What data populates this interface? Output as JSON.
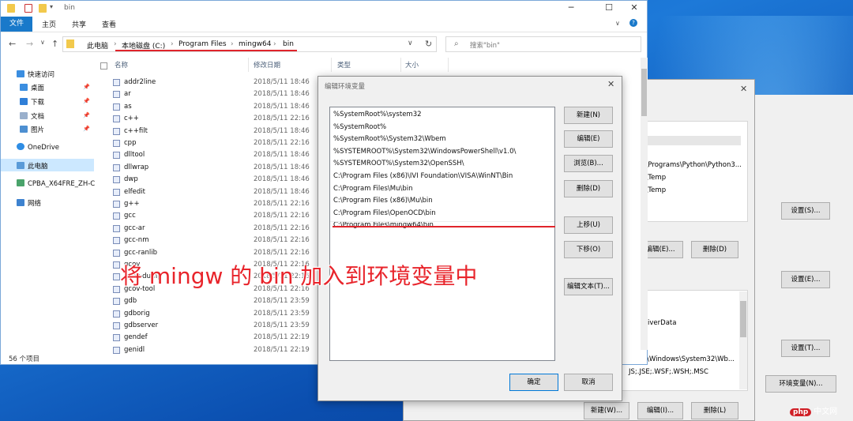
{
  "explorer": {
    "title": "bin",
    "ribbon": {
      "file": "文件",
      "tabs": [
        "主页",
        "共享",
        "查看"
      ]
    },
    "nav": {
      "back": "←",
      "forward": "→",
      "dropdown": "∨",
      "up": "↑",
      "refresh": "↻"
    },
    "address": [
      "此电脑",
      "本地磁盘 (C:)",
      "Program Files",
      "mingw64",
      "bin"
    ],
    "search_placeholder": "搜索\"bin\"",
    "sidebar": [
      {
        "label": "快速访问",
        "pinned": false
      },
      {
        "label": "桌面",
        "pinned": true
      },
      {
        "label": "下载",
        "pinned": true
      },
      {
        "label": "文档",
        "pinned": true
      },
      {
        "label": "图片",
        "pinned": true
      },
      {
        "label": "OneDrive",
        "pinned": false
      },
      {
        "label": "此电脑",
        "pinned": false
      },
      {
        "label": "CPBA_X64FRE_ZH-C",
        "pinned": false
      },
      {
        "label": "网络",
        "pinned": false
      }
    ],
    "columns": {
      "name": "名称",
      "date": "修改日期",
      "type": "类型",
      "size": "大小"
    },
    "files": [
      {
        "name": "addr2line",
        "date": "2018/5/11 18:46"
      },
      {
        "name": "ar",
        "date": "2018/5/11 18:46"
      },
      {
        "name": "as",
        "date": "2018/5/11 18:46"
      },
      {
        "name": "c++",
        "date": "2018/5/11 22:16"
      },
      {
        "name": "c++filt",
        "date": "2018/5/11 18:46"
      },
      {
        "name": "cpp",
        "date": "2018/5/11 22:16"
      },
      {
        "name": "dlltool",
        "date": "2018/5/11 18:46"
      },
      {
        "name": "dllwrap",
        "date": "2018/5/11 18:46"
      },
      {
        "name": "dwp",
        "date": "2018/5/11 18:46"
      },
      {
        "name": "elfedit",
        "date": "2018/5/11 18:46"
      },
      {
        "name": "g++",
        "date": "2018/5/11 22:16"
      },
      {
        "name": "gcc",
        "date": "2018/5/11 22:16"
      },
      {
        "name": "gcc-ar",
        "date": "2018/5/11 22:16"
      },
      {
        "name": "gcc-nm",
        "date": "2018/5/11 22:16"
      },
      {
        "name": "gcc-ranlib",
        "date": "2018/5/11 22:16"
      },
      {
        "name": "gcov",
        "date": "2018/5/11 22:16"
      },
      {
        "name": "gcov-dump",
        "date": "2018/5/11 22:16"
      },
      {
        "name": "gcov-tool",
        "date": "2018/5/11 22:16"
      },
      {
        "name": "gdb",
        "date": "2018/5/11 23:59"
      },
      {
        "name": "gdborig",
        "date": "2018/5/11 23:59"
      },
      {
        "name": "gdbserver",
        "date": "2018/5/11 23:59"
      },
      {
        "name": "gendef",
        "date": "2018/5/11 22:19"
      },
      {
        "name": "genidl",
        "date": "2018/5/11 22:19"
      }
    ],
    "status": "56 个项目"
  },
  "envwin": {
    "user_var_values": [
      "al\\Programs\\Python\\Python3...",
      "al\\Temp",
      "al\\Temp"
    ],
    "user_buttons": [
      "编辑(E)...",
      "删除(D)"
    ],
    "sys_var_values": [
      "DriverData",
      "ws;C:\\Windows\\System32\\Wb...",
      "JS;.JSE;.WSF;.WSH;.MSC"
    ],
    "sys_buttons": [
      "新建(W)...",
      "编辑(I)...",
      "删除(L)"
    ]
  },
  "sysprops": {
    "settings_buttons": [
      "设置(S)...",
      "设置(E)...",
      "设置(T)..."
    ],
    "env_button": "环境变量(N)..."
  },
  "dialog": {
    "title": "编辑环境变量",
    "close": "✕",
    "paths": [
      "%SystemRoot%\\system32",
      "%SystemRoot%",
      "%SystemRoot%\\System32\\Wbem",
      "%SYSTEMROOT%\\System32\\WindowsPowerShell\\v1.0\\",
      "%SYSTEMROOT%\\System32\\OpenSSH\\",
      "C:\\Program Files (x86)\\IVI Foundation\\VISA\\WinNT\\Bin",
      "C:\\Program Files\\Mu\\bin",
      "C:\\Program Files (x86)\\Mu\\bin",
      "C:\\Program Files\\OpenOCD\\bin",
      "C:\\Program Files\\mingw64\\bin"
    ],
    "buttons": {
      "new": "新建(N)",
      "edit": "编辑(E)",
      "browse": "浏览(B)...",
      "delete": "删除(D)",
      "up": "上移(U)",
      "down": "下移(O)",
      "edit_text": "编辑文本(T)...",
      "ok": "确定",
      "cancel": "取消"
    }
  },
  "annotation": "将 mingw 的 bin 加入到环境变量中",
  "watermark": {
    "badge": "php",
    "text": "中文网"
  },
  "colors": {
    "accent": "#1979ca",
    "highlight_red": "#e0242b",
    "desktop": "#0a5ec9"
  }
}
